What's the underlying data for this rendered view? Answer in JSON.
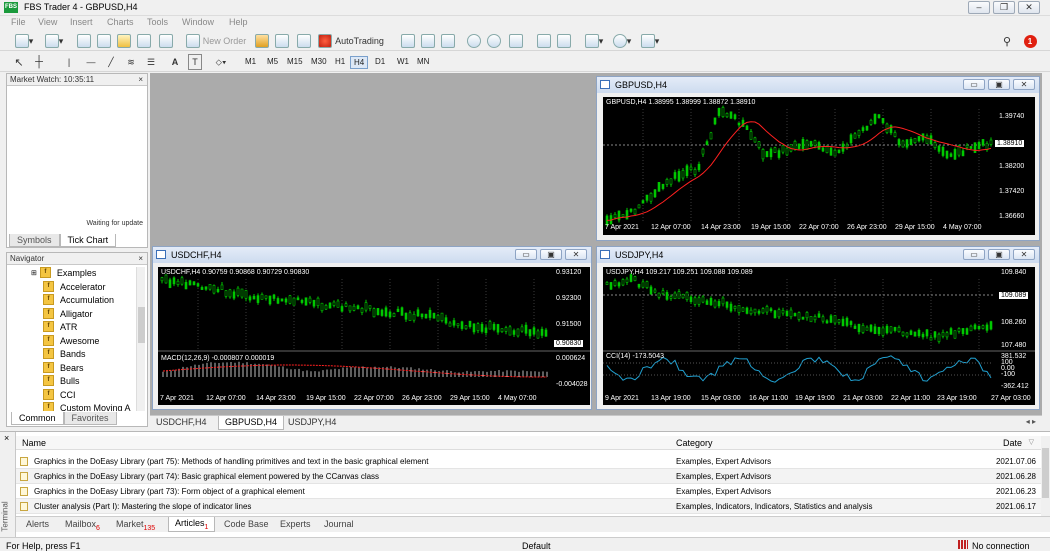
{
  "app": {
    "title": "FBS Trader 4 - GBPUSD,H4",
    "logo_text": "FBS"
  },
  "menu": [
    "File",
    "View",
    "Insert",
    "Charts",
    "Tools",
    "Window",
    "Help"
  ],
  "toolbar": {
    "new_order": "New Order",
    "autotrading": "AutoTrading",
    "notification_count": "1"
  },
  "drawing_toolbar": {
    "text_a": "A",
    "text_label": "T"
  },
  "timeframes": [
    "M1",
    "M5",
    "M15",
    "M30",
    "H1",
    "H4",
    "D1",
    "W1",
    "MN"
  ],
  "active_timeframe": "H4",
  "market_watch": {
    "title": "Market Watch: 10:35:11",
    "waiting": "Waiting for update",
    "tabs": [
      "Symbols",
      "Tick Chart"
    ],
    "active_tab": "Tick Chart"
  },
  "navigator": {
    "title": "Navigator",
    "items": [
      "Examples",
      "Accelerator",
      "Accumulation",
      "Alligator",
      "ATR",
      "Awesome",
      "Bands",
      "Bears",
      "Bulls",
      "CCI",
      "Custom Moving A"
    ],
    "tabs": [
      "Common",
      "Favorites"
    ],
    "active_tab": "Common"
  },
  "charts": {
    "gbpusd": {
      "window_title": "GBPUSD,H4",
      "info": "GBPUSD,H4  1.38995 1.38999 1.38872 1.38910",
      "price_labels": [
        "1.39740",
        "1.38910",
        "1.38200",
        "1.37420",
        "1.36660"
      ],
      "current_price": "1.38910",
      "time_labels": [
        "7 Apr 2021",
        "12 Apr 07:00",
        "14 Apr 23:00",
        "19 Apr 15:00",
        "22 Apr 07:00",
        "26 Apr 23:00",
        "29 Apr 15:00",
        "4 May 07:00"
      ]
    },
    "usdchf": {
      "window_title": "USDCHF,H4",
      "info": "USDCHF,H4  0.90759 0.90868 0.90729 0.90830",
      "price_labels": [
        "0.93120",
        "0.92300",
        "0.91500",
        "0.90830"
      ],
      "current_price": "0.90830",
      "indicator_info": "MACD(12,26,9) -0.000807 0.000019",
      "indicator_labels": [
        "0.000624",
        "0.00",
        "-0.004028"
      ],
      "time_labels": [
        "7 Apr 2021",
        "12 Apr 07:00",
        "14 Apr 23:00",
        "19 Apr 15:00",
        "22 Apr 07:00",
        "26 Apr 23:00",
        "29 Apr 15:00",
        "4 May 07:00"
      ]
    },
    "usdjpy": {
      "window_title": "USDJPY,H4",
      "info": "USDJPY,H4  109.217 109.251 109.088 109.089",
      "price_labels": [
        "109.840",
        "109.089",
        "108.260",
        "107.480"
      ],
      "current_price": "109.089",
      "indicator_info": "CCI(14) -173.5043",
      "indicator_labels": [
        "381.532",
        "100",
        "0.00",
        "-100",
        "-362.412"
      ],
      "time_labels": [
        "9 Apr 2021",
        "13 Apr 19:00",
        "15 Apr 03:00",
        "16 Apr 11:00",
        "19 Apr 19:00",
        "21 Apr 03:00",
        "22 Apr 11:00",
        "23 Apr 19:00",
        "27 Apr 03:00"
      ]
    }
  },
  "chart_tabs": [
    "USDCHF,H4",
    "GBPUSD,H4",
    "USDJPY,H4"
  ],
  "active_chart_tab": "GBPUSD,H4",
  "terminal": {
    "label": "Terminal",
    "columns": {
      "name": "Name",
      "category": "Category",
      "date": "Date"
    },
    "rows": [
      {
        "name": "Graphics in the DoEasy Library (part 75): Methods of handling primitives and text in the basic graphical element",
        "category": "Examples, Expert Advisors",
        "date": "2021.07.06"
      },
      {
        "name": "Graphics in the DoEasy Library (part 74): Basic graphical element powered by the CCanvas class",
        "category": "Examples, Expert Advisors",
        "date": "2021.06.28"
      },
      {
        "name": "Graphics in the DoEasy Library (part 73): Form object of a graphical element",
        "category": "Examples, Expert Advisors",
        "date": "2021.06.23"
      },
      {
        "name": "Cluster analysis (Part I): Mastering the slope of indicator lines",
        "category": "Examples, Indicators, Indicators, Statistics and analysis",
        "date": "2021.06.17"
      }
    ],
    "tabs": [
      {
        "label": "Alerts",
        "count": ""
      },
      {
        "label": "Mailbox",
        "count": "6"
      },
      {
        "label": "Market",
        "count": "135"
      },
      {
        "label": "Articles",
        "count": "1"
      },
      {
        "label": "Code Base",
        "count": ""
      },
      {
        "label": "Experts",
        "count": ""
      },
      {
        "label": "Journal",
        "count": ""
      }
    ],
    "active_tab": "Articles"
  },
  "status": {
    "help": "For Help, press F1",
    "profile": "Default",
    "connection": "No connection"
  },
  "colors": {
    "chart_bg": "#000000",
    "bull_candle": "#00c800",
    "ma_line": "#ff2020",
    "grid": "#3a3a3a",
    "cci_line": "#20a0d0"
  }
}
